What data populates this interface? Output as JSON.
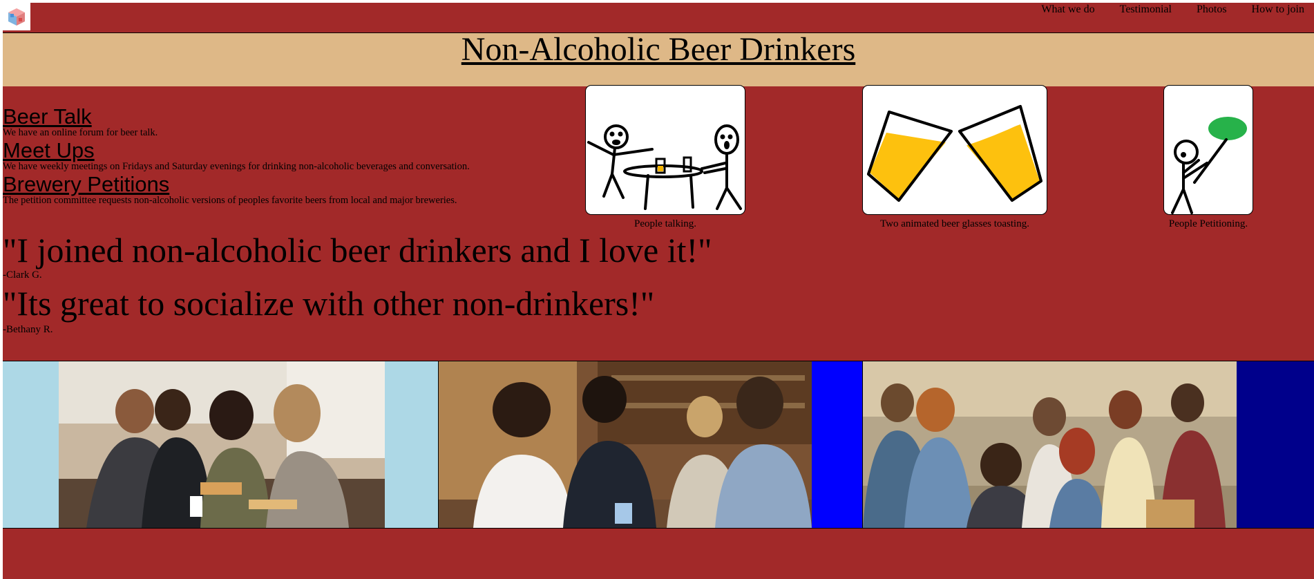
{
  "nav": {
    "items": [
      "What we do",
      "Testimonial",
      "Photos",
      "How to join"
    ]
  },
  "header": {
    "title": "Non-Alcoholic Beer Drinkers"
  },
  "what_we_do": [
    {
      "title": "Beer Talk",
      "text": "We have an online forum for beer talk."
    },
    {
      "title": "Meet Ups",
      "text": "We have weekly meetings on Fridays and Saturday evenings for drinking non-alcoholic beverages and conversation."
    },
    {
      "title": "Brewery Petitions",
      "text": "The petition committee requests non-alcoholic versions of peoples favorite beers from local and major breweries."
    }
  ],
  "cards": [
    {
      "caption": "People talking."
    },
    {
      "caption": "Two animated beer glasses toasting."
    },
    {
      "caption": "People Petitioning."
    }
  ],
  "testimonials": [
    {
      "quote": "\"I joined non-alcoholic beer drinkers and I love it!\"",
      "author": "-Clark G."
    },
    {
      "quote": "\"Its great to socialize with other non-drinkers!\"",
      "author": "-Bethany R."
    }
  ],
  "colors": {
    "page_bg": "#a22929",
    "title_band": "#deb887",
    "strip_light_blue": "#add8e6",
    "strip_blue": "#0000ff",
    "strip_navy": "#00008b"
  }
}
